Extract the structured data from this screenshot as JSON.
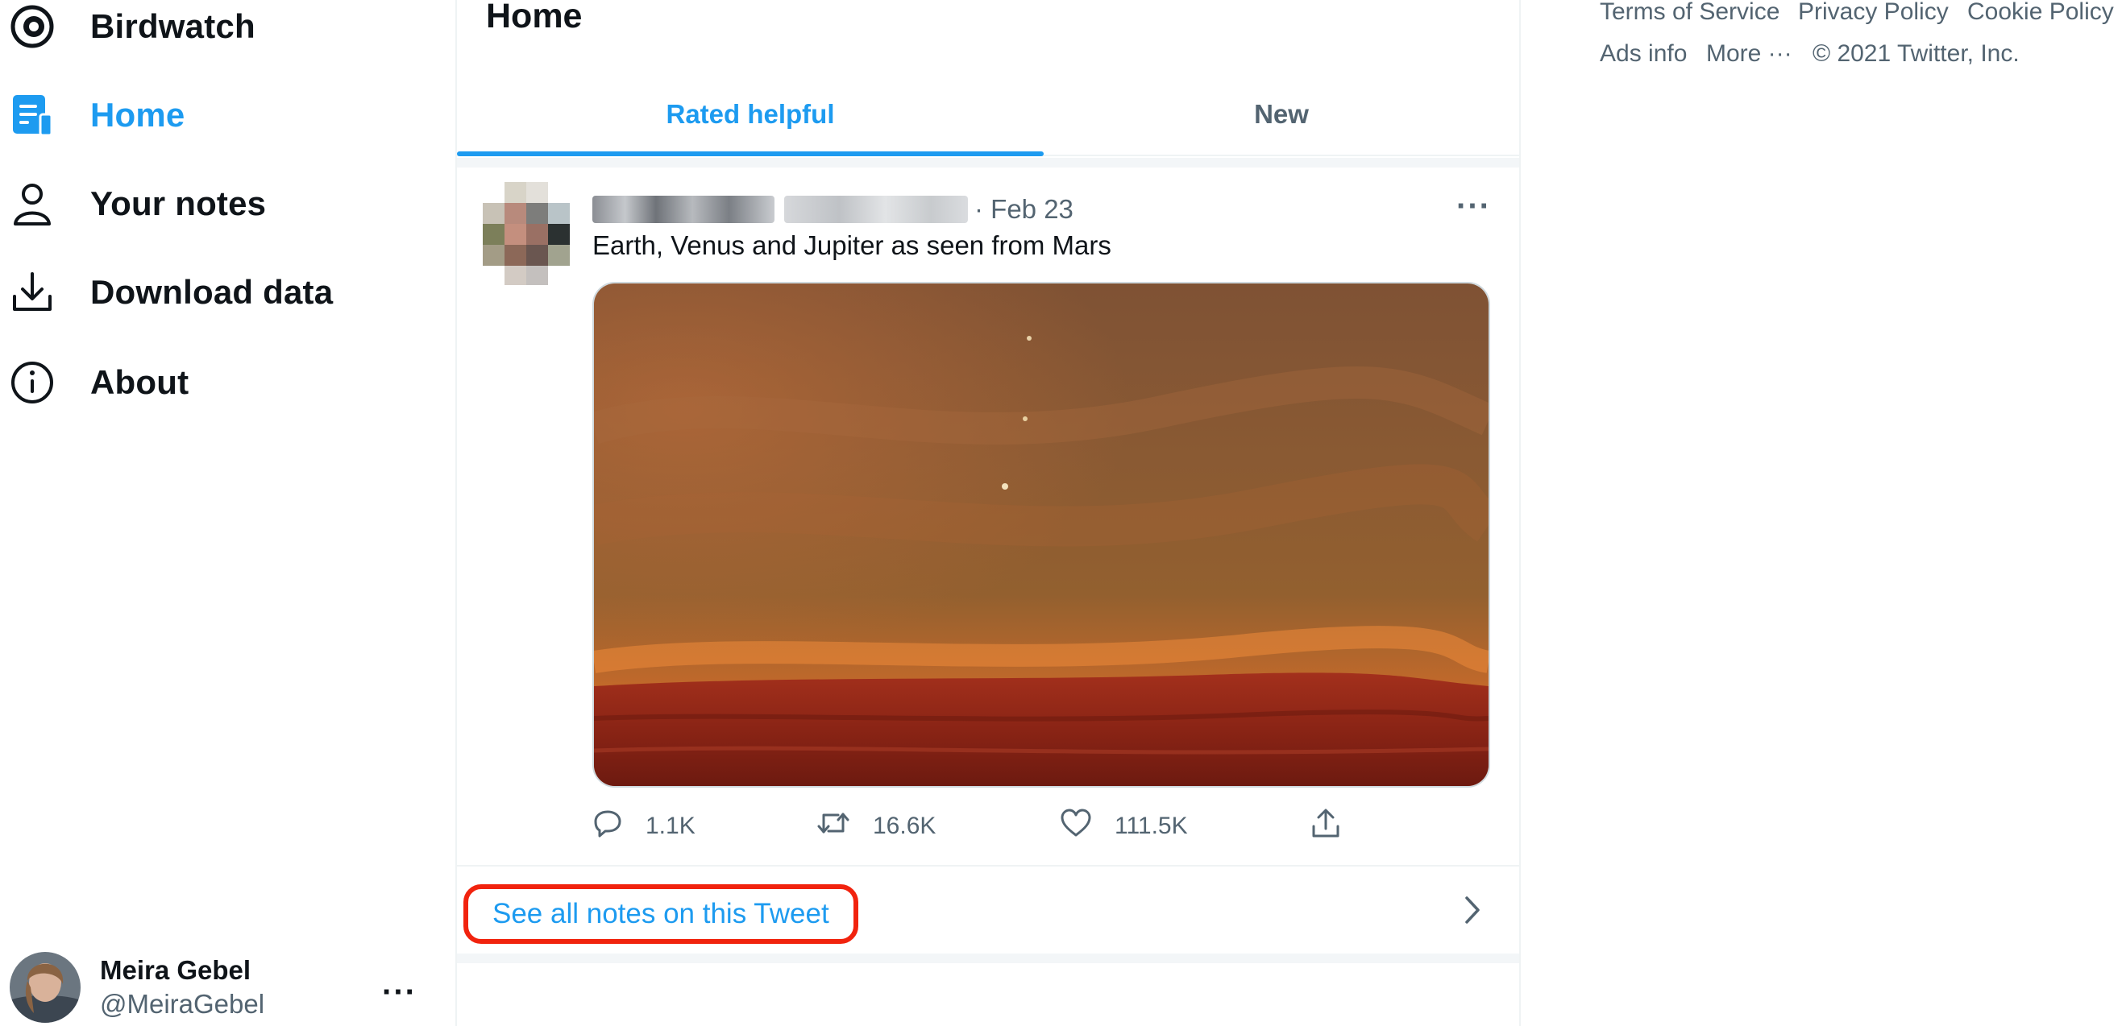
{
  "app": {
    "title": "Birdwatch"
  },
  "sidebar": {
    "items": [
      {
        "label": "Home",
        "icon": "home-note-icon",
        "active": true
      },
      {
        "label": "Your notes",
        "icon": "person-icon"
      },
      {
        "label": "Download data",
        "icon": "download-icon"
      },
      {
        "label": "About",
        "icon": "info-icon"
      }
    ]
  },
  "user": {
    "name": "Meira Gebel",
    "handle": "@MeiraGebel",
    "more": "···"
  },
  "main": {
    "title": "Home",
    "tabs": [
      {
        "label": "Rated helpful",
        "active": true
      },
      {
        "label": "New"
      }
    ]
  },
  "tweet": {
    "date": "· Feb 23",
    "text": "Earth, Venus and Jupiter as seen from Mars",
    "more": "···",
    "actions": {
      "replies": "1.1K",
      "retweets": "16.6K",
      "likes": "111.5K"
    },
    "notes_link": "See all notes on this Tweet"
  },
  "footer": {
    "links": [
      "Terms of Service",
      "Privacy Policy",
      "Cookie Policy",
      "Ads info",
      "More ···"
    ],
    "copyright": "© 2021 Twitter, Inc."
  },
  "colors": {
    "accent": "#1d9bf0",
    "text": "#0f1419",
    "muted": "#536471",
    "highlight": "#f1230e"
  }
}
